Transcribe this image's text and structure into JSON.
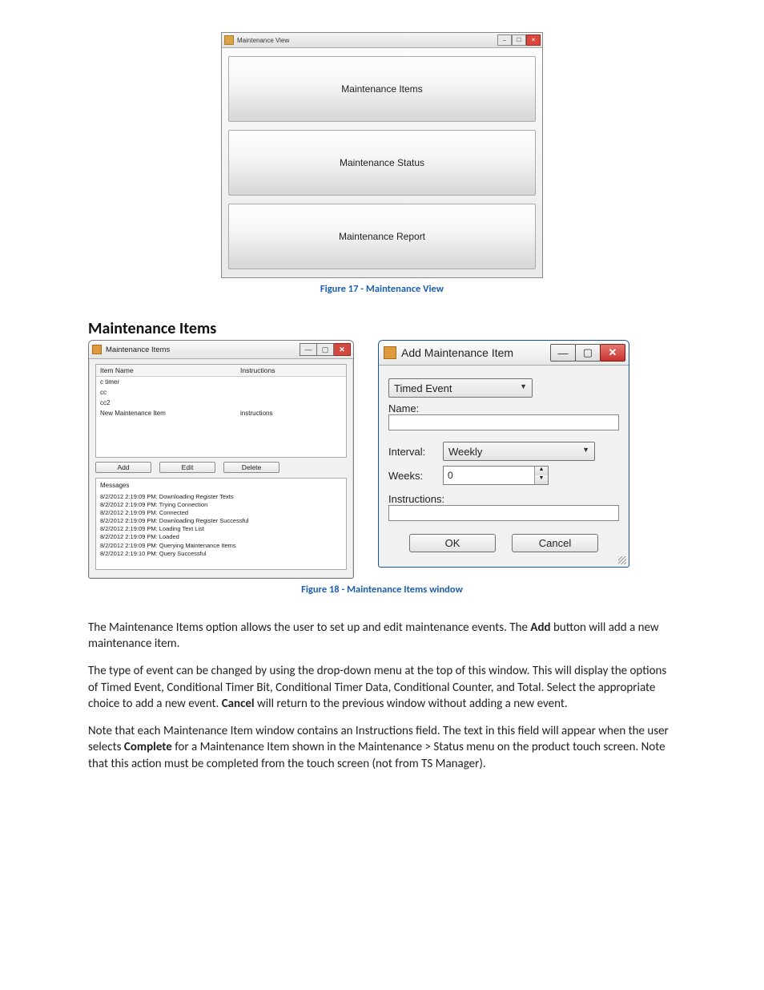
{
  "figure17": {
    "window_title": "Maintenance View",
    "buttons": [
      "Maintenance Items",
      "Maintenance Status",
      "Maintenance Report"
    ],
    "caption": "Figure 17 - Maintenance View"
  },
  "section_heading": "Maintenance Items",
  "mi_window": {
    "title": "Maintenance Items",
    "columns": {
      "name": "Item Name",
      "instructions": "Instructions"
    },
    "rows": [
      {
        "name": "c timer",
        "instructions": ""
      },
      {
        "name": "cc",
        "instructions": ""
      },
      {
        "name": "cc2",
        "instructions": ""
      },
      {
        "name": "New Maintenance Item",
        "instructions": "instructions"
      }
    ],
    "buttons": {
      "add": "Add",
      "edit": "Edit",
      "delete": "Delete"
    },
    "messages_label": "Messages",
    "messages": [
      "8/2/2012 2:19:09 PM: Downloading Register Texts",
      "8/2/2012 2:19:09 PM: Trying Connection",
      "8/2/2012 2:19:09 PM: Connected",
      "8/2/2012 2:19:09 PM: Downloading Register Successful",
      "8/2/2012 2:19:09 PM: Loading Text List",
      "8/2/2012 2:19:09 PM: Loaded",
      "8/2/2012 2:19:09 PM: Querying Maintenance Items",
      "8/2/2012 2:19:10 PM: Query Successful"
    ]
  },
  "add_window": {
    "title": "Add Maintenance Item",
    "event_type": "Timed Event",
    "name_label": "Name:",
    "name_value": "",
    "interval_label": "Interval:",
    "interval_value": "Weekly",
    "weeks_label": "Weeks:",
    "weeks_value": "0",
    "instructions_label": "Instructions:",
    "instructions_value": "",
    "ok": "OK",
    "cancel": "Cancel"
  },
  "figure18_caption": "Figure 18 - Maintenance Items window",
  "para1": {
    "t1": "The Maintenance Items option allows the user to set up and edit maintenance events.  The ",
    "b1": "Add",
    "t2": " button will add a new maintenance item."
  },
  "para2": {
    "t1": "The type of event can be changed by using the drop-down menu at the top of this window.  This will display the options of Timed Event, Conditional Timer Bit, Conditional Timer Data, Conditional Counter, and Total.  Select the appropriate choice to add a new event.  ",
    "b1": "Cancel",
    "t2": " will return to the previous window without adding a new event."
  },
  "para3": {
    "t1": "Note that each Maintenance Item window contains an Instructions field. The text in this field will appear when the user selects ",
    "b1": "Complete",
    "t2": " for a Maintenance Item shown in the Maintenance > Status menu on the product touch screen. Note that this action must be completed from the touch screen (not from TS Manager)."
  }
}
